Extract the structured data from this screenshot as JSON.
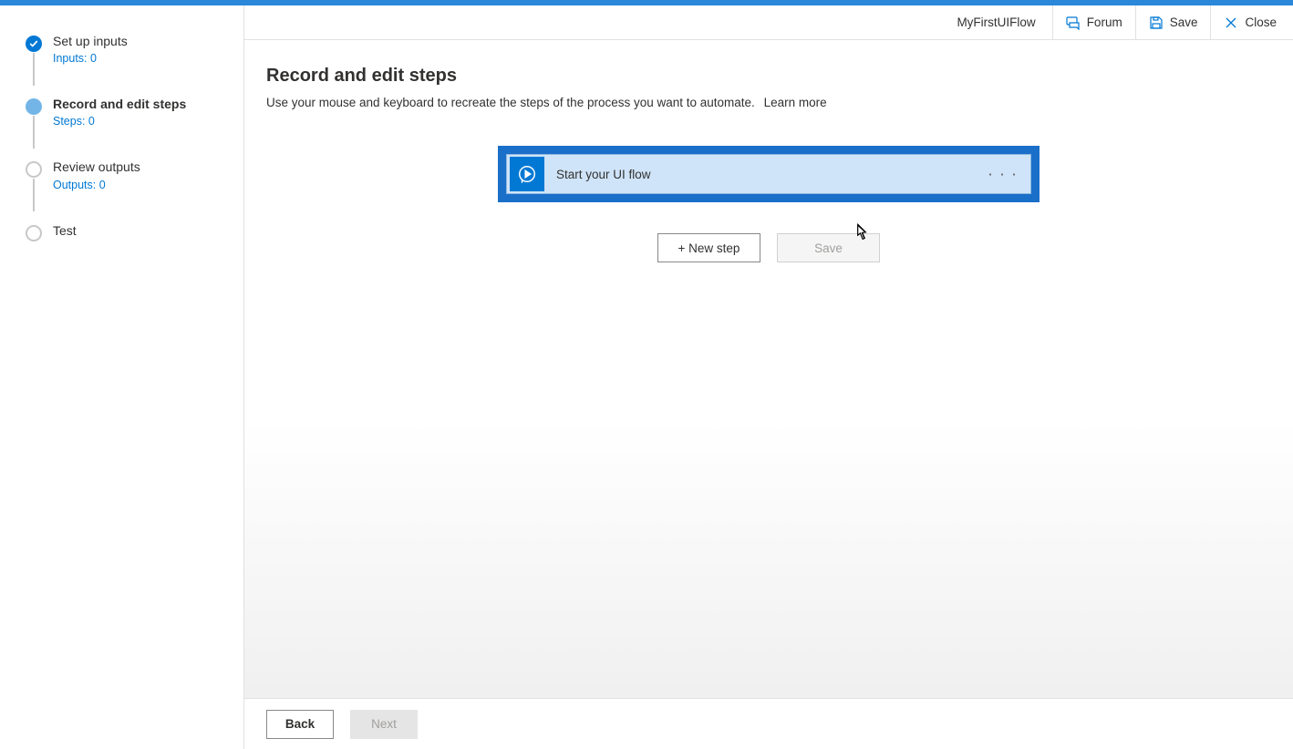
{
  "colors": {
    "accent": "#0078d4",
    "topbar": "#2b88d8",
    "card_border": "#1a6fc9",
    "card_bg": "#cfe4f8"
  },
  "header": {
    "flow_name": "MyFirstUIFlow",
    "forum": "Forum",
    "save": "Save",
    "close": "Close"
  },
  "steps": [
    {
      "title": "Set up inputs",
      "sub": "Inputs: 0",
      "state": "completed"
    },
    {
      "title": "Record and edit steps",
      "sub": "Steps: 0",
      "state": "current"
    },
    {
      "title": "Review outputs",
      "sub": "Outputs: 0",
      "state": "pending"
    },
    {
      "title": "Test",
      "sub": "",
      "state": "pending"
    }
  ],
  "page": {
    "title": "Record and edit steps",
    "description": "Use your mouse and keyboard to recreate the steps of the process you want to automate.",
    "learn_more": "Learn more"
  },
  "flow_card": {
    "label": "Start your UI flow",
    "menu_icon": "· · ·"
  },
  "actions": {
    "new_step": "+ New step",
    "save": "Save"
  },
  "footer": {
    "back": "Back",
    "next": "Next"
  }
}
